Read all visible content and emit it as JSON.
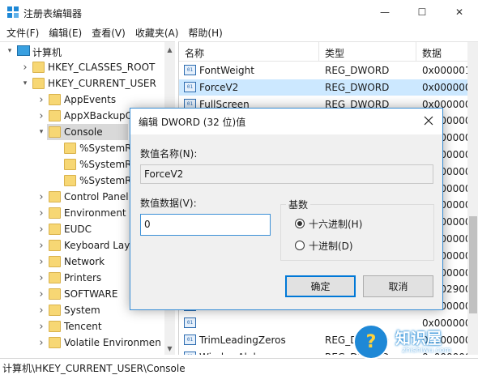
{
  "window": {
    "title": "注册表编辑器",
    "controls": {
      "minimize": "—",
      "maximize": "☐",
      "close": "✕"
    }
  },
  "menu": [
    "文件(F)",
    "编辑(E)",
    "查看(V)",
    "收藏夹(A)",
    "帮助(H)"
  ],
  "tree": [
    {
      "label": "计算机",
      "level": 0,
      "expanded": true,
      "icon": "computer-icon"
    },
    {
      "label": "HKEY_CLASSES_ROOT",
      "level": 1,
      "expanded": false,
      "icon": "folder-icon"
    },
    {
      "label": "HKEY_CURRENT_USER",
      "level": 1,
      "expanded": true,
      "icon": "folder-icon"
    },
    {
      "label": "AppEvents",
      "level": 2,
      "expanded": false,
      "icon": "folder-icon"
    },
    {
      "label": "AppXBackupC",
      "level": 2,
      "expanded": false,
      "icon": "folder-icon"
    },
    {
      "label": "Console",
      "level": 2,
      "expanded": true,
      "selected": true,
      "icon": "folder-icon"
    },
    {
      "label": "%SystemR",
      "level": 3,
      "icon": "folder-icon"
    },
    {
      "label": "%SystemR",
      "level": 3,
      "icon": "folder-icon"
    },
    {
      "label": "%SystemR",
      "level": 3,
      "icon": "folder-icon"
    },
    {
      "label": "Control Panel",
      "level": 2,
      "expanded": false,
      "icon": "folder-icon"
    },
    {
      "label": "Environment",
      "level": 2,
      "icon": "folder-icon"
    },
    {
      "label": "EUDC",
      "level": 2,
      "expanded": false,
      "icon": "folder-icon"
    },
    {
      "label": "Keyboard Lay",
      "level": 2,
      "expanded": false,
      "icon": "folder-icon"
    },
    {
      "label": "Network",
      "level": 2,
      "icon": "folder-icon"
    },
    {
      "label": "Printers",
      "level": 2,
      "expanded": false,
      "icon": "folder-icon"
    },
    {
      "label": "SOFTWARE",
      "level": 2,
      "expanded": false,
      "icon": "folder-icon"
    },
    {
      "label": "System",
      "level": 2,
      "expanded": false,
      "icon": "folder-icon"
    },
    {
      "label": "Tencent",
      "level": 2,
      "expanded": false,
      "icon": "folder-icon"
    },
    {
      "label": "Volatile Environmen",
      "level": 2,
      "expanded": false,
      "icon": "folder-icon"
    }
  ],
  "list": {
    "headers": [
      "名称",
      "类型",
      "数据"
    ],
    "rows": [
      {
        "name": "FontWeight",
        "type": "REG_DWORD",
        "data": "0x000001"
      },
      {
        "name": "ForceV2",
        "type": "REG_DWORD",
        "data": "0x000000",
        "selected": true
      },
      {
        "name": "FullScreen",
        "type": "REG_DWORD",
        "data": "0x000000"
      },
      {
        "name": "",
        "type": "",
        "data": "0x000000"
      },
      {
        "name": "",
        "type": "",
        "data": "0x000000"
      },
      {
        "name": "",
        "type": "",
        "data": "0x000000"
      },
      {
        "name": "",
        "type": "",
        "data": "0x000000"
      },
      {
        "name": "",
        "type": "",
        "data": "0x000000"
      },
      {
        "name": "",
        "type": "",
        "data": "0x000000"
      },
      {
        "name": "",
        "type": "",
        "data": "0x000000"
      },
      {
        "name": "",
        "type": "",
        "data": "0x000000"
      },
      {
        "name": "",
        "type": "",
        "data": "0x000000"
      },
      {
        "name": "",
        "type": "",
        "data": "0x000000"
      },
      {
        "name": "",
        "type": "",
        "data": "0x002900"
      },
      {
        "name": "",
        "type": "",
        "data": "0x000000"
      },
      {
        "name": "",
        "type": "",
        "data": "0x000000"
      },
      {
        "name": "TrimLeadingZeros",
        "type": "REG_DWORD",
        "data": "0x000000"
      },
      {
        "name": "WindowAlpha",
        "type": "REG_DWORD",
        "data": "0x000000"
      }
    ]
  },
  "dialog": {
    "title": "编辑 DWORD (32 位)值",
    "name_label": "数值名称(N):",
    "name_value": "ForceV2",
    "data_label": "数值数据(V):",
    "data_value": "0",
    "base_label": "基数",
    "base_options": [
      {
        "label": "十六进制(H)",
        "checked": true
      },
      {
        "label": "十进制(D)",
        "checked": false
      }
    ],
    "ok": "确定",
    "cancel": "取消"
  },
  "status": "计算机\\HKEY_CURRENT_USER\\Console",
  "watermark": {
    "title": "知识屋",
    "subtitle": "zhishiwu.com"
  },
  "colors": {
    "accent": "#0078d7",
    "selection_list": "#cce8ff",
    "selection_tree": "#d9d9d9",
    "folder": "#f7d774",
    "dialog_border": "#3b8fd6",
    "watermark_blue": "#1e88d6"
  }
}
